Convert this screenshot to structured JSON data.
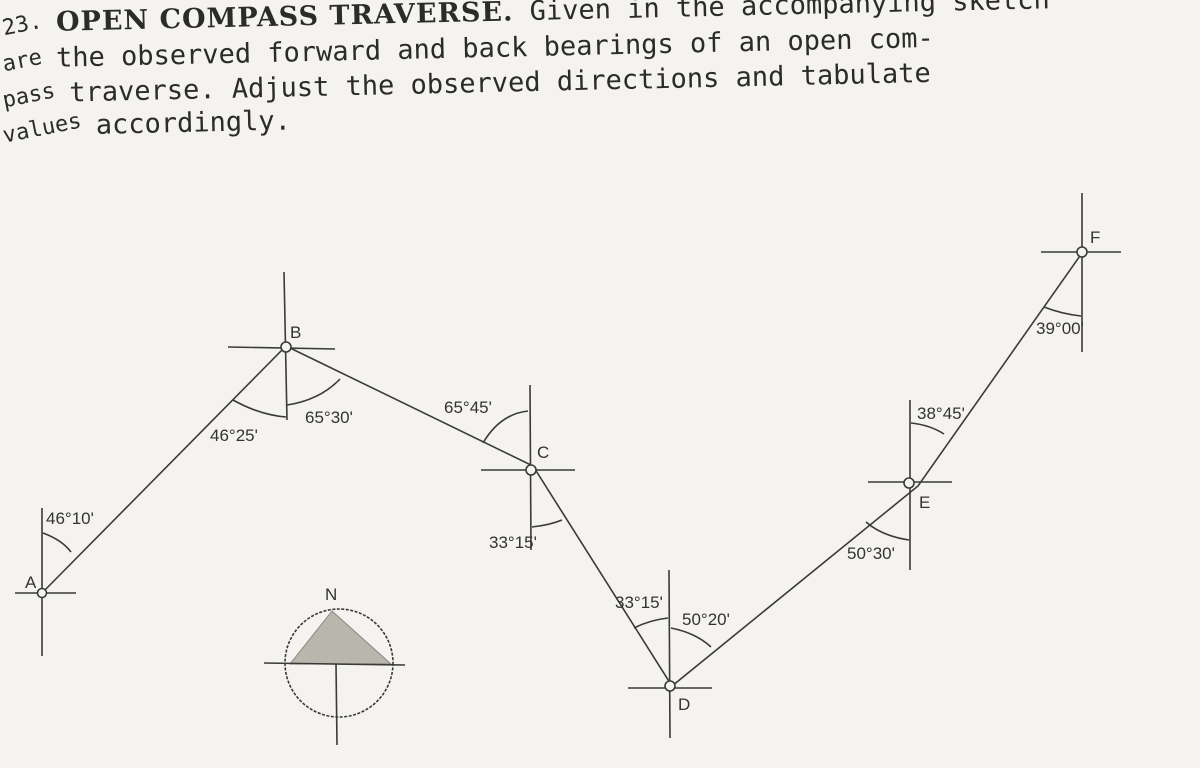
{
  "problem": {
    "number": "23.",
    "heading": "OPEN COMPASS TRAVERSE.",
    "line1_rest": "Given in the accompanying sketch",
    "line2_lead": "are",
    "line2": "the observed forward and back bearings of an open com-",
    "line3_lead": "pass",
    "line3": "traverse.  Adjust the observed directions and tabulate",
    "line4_lead": "values",
    "line4": "accordingly."
  },
  "sketch": {
    "stations": [
      {
        "id": "A",
        "label": "A"
      },
      {
        "id": "B",
        "label": "B"
      },
      {
        "id": "C",
        "label": "C"
      },
      {
        "id": "D",
        "label": "D"
      },
      {
        "id": "E",
        "label": "E"
      },
      {
        "id": "F",
        "label": "F"
      }
    ],
    "bearings": [
      {
        "at": "A",
        "toward": "B",
        "type": "forward",
        "label": "46°10'"
      },
      {
        "at": "B",
        "toward": "A",
        "type": "back",
        "label": "46°25'"
      },
      {
        "at": "B",
        "toward": "C",
        "type": "forward",
        "label": "65°30'"
      },
      {
        "at": "C",
        "toward": "B",
        "type": "back",
        "label": "65°45'"
      },
      {
        "at": "C",
        "toward": "D",
        "type": "forward",
        "label": "33°15'"
      },
      {
        "at": "D",
        "toward": "C",
        "type": "back",
        "label": "33°15'"
      },
      {
        "at": "D",
        "toward": "E",
        "type": "forward",
        "label": "50°20'"
      },
      {
        "at": "E",
        "toward": "D",
        "type": "back",
        "label": "50°30'"
      },
      {
        "at": "E",
        "toward": "F",
        "type": "forward",
        "label": "38°45'"
      },
      {
        "at": "F",
        "toward": "E",
        "type": "back",
        "label": "39°00'"
      }
    ],
    "north_arrow": {
      "label": "N"
    }
  }
}
